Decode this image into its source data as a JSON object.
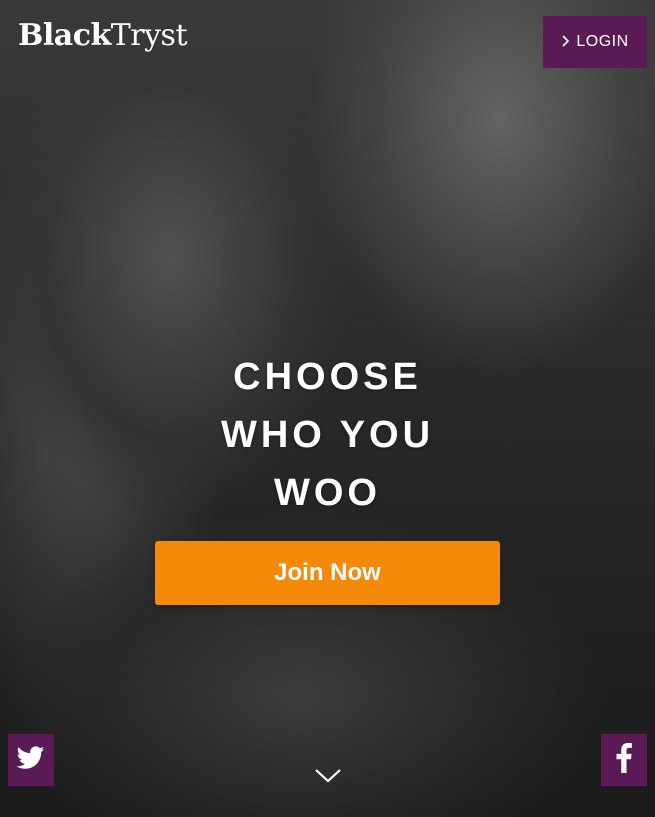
{
  "brand": {
    "logo_bold": "Black",
    "logo_light": "Tryst"
  },
  "header": {
    "login_label": "LOGIN",
    "login_icon": "chevron-right-icon"
  },
  "hero": {
    "headline_lines": [
      "CHOOSE",
      "WHO YOU",
      "WOO"
    ],
    "cta_label": "Join Now"
  },
  "social": {
    "twitter_icon": "twitter-icon",
    "facebook_icon": "facebook-icon"
  },
  "footer": {
    "scroll_icon": "chevron-down-icon"
  },
  "colors": {
    "brand_purple": "#5a1a56",
    "cta_orange": "#f58a0a",
    "text_white": "#ffffff"
  }
}
